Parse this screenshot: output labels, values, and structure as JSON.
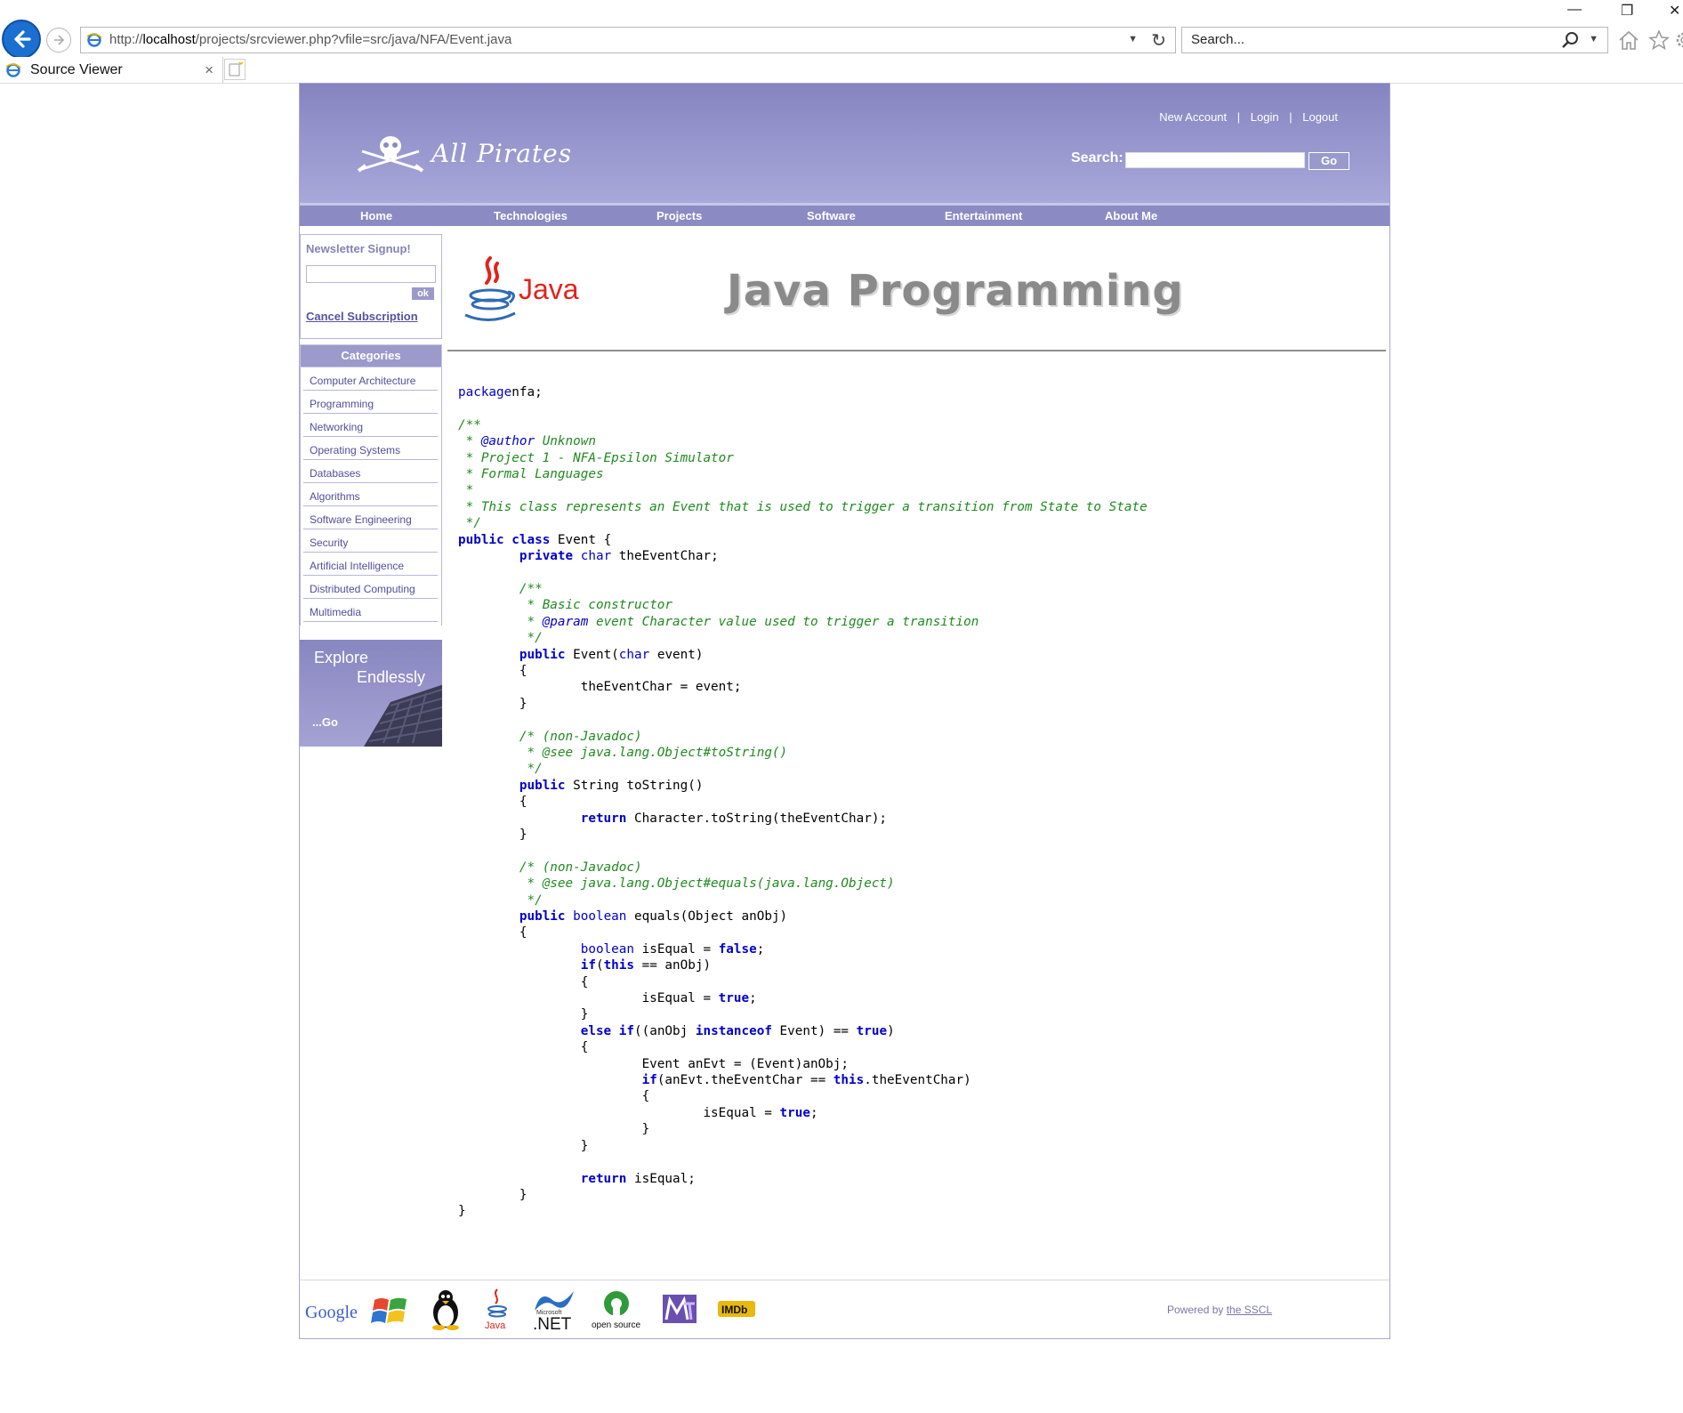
{
  "browser": {
    "url_prefix": "http://",
    "url_host": "localhost",
    "url_path": "/projects/srcviewer.php?vfile=src/java/NFA/Event.java",
    "search_placeholder": "Search...",
    "tab_title": "Source Viewer",
    "tab_close": "×"
  },
  "header": {
    "site_name": "All Pirates",
    "links": [
      "New Account",
      "Login",
      "Logout"
    ],
    "link_separator": "|",
    "search_label": "Search:",
    "go_label": "Go"
  },
  "nav": {
    "items": [
      "Home",
      "Technologies",
      "Projects",
      "Software",
      "Entertainment",
      "About Me"
    ]
  },
  "sidebar": {
    "newsletter_title": "Newsletter Signup!",
    "ok_label": "ok",
    "cancel_label": "Cancel Subscription",
    "categories_title": "Categories",
    "categories": [
      "Computer Architecture",
      "Programming",
      "Networking",
      "Operating Systems",
      "Databases",
      "Algorithms",
      "Software Engineering",
      "Security",
      "Artificial Intelligence",
      "Distributed Computing",
      "Multimedia"
    ],
    "explore_line1": "Explore",
    "explore_line2": "Endlessly",
    "explore_go": "...Go"
  },
  "content": {
    "java_logo_text": "Java",
    "banner_title": "Java Programming",
    "code": [
      [
        [
          "kw",
          "package"
        ],
        [
          "",
          "nfa;"
        ]
      ],
      [],
      [
        [
          "cm",
          "/**"
        ]
      ],
      [
        [
          "cm",
          " * "
        ],
        [
          "tag",
          "@author"
        ],
        [
          "cm",
          " Unknown"
        ]
      ],
      [
        [
          "cm",
          " * Project 1 - NFA-Epsilon Simulator"
        ]
      ],
      [
        [
          "cm",
          " * Formal Languages"
        ]
      ],
      [
        [
          "cm",
          " *"
        ]
      ],
      [
        [
          "cm",
          " * This class represents an Event that is used to trigger a transition from State to State"
        ]
      ],
      [
        [
          "cm",
          " */"
        ]
      ],
      [
        [
          "bkw",
          "public"
        ],
        [
          "",
          " "
        ],
        [
          "bkw",
          "class"
        ],
        [
          "",
          " Event {"
        ]
      ],
      [
        [
          "",
          "        "
        ],
        [
          "bkw",
          "private"
        ],
        [
          "",
          " "
        ],
        [
          "kw",
          "char"
        ],
        [
          "",
          " theEventChar;"
        ]
      ],
      [],
      [
        [
          "",
          "        "
        ],
        [
          "cm",
          "/**"
        ]
      ],
      [
        [
          "",
          "        "
        ],
        [
          "cm",
          " * Basic constructor"
        ]
      ],
      [
        [
          "",
          "        "
        ],
        [
          "cm",
          " * "
        ],
        [
          "tag",
          "@param"
        ],
        [
          "cm",
          " event Character value used to trigger a transition"
        ]
      ],
      [
        [
          "",
          "        "
        ],
        [
          "cm",
          " */"
        ]
      ],
      [
        [
          "",
          "        "
        ],
        [
          "bkw",
          "public"
        ],
        [
          "",
          " Event("
        ],
        [
          "kw",
          "char"
        ],
        [
          "",
          " event)"
        ]
      ],
      [
        [
          "",
          "        {"
        ]
      ],
      [
        [
          "",
          "                theEventChar = event;"
        ]
      ],
      [
        [
          "",
          "        }"
        ]
      ],
      [],
      [
        [
          "",
          "        "
        ],
        [
          "cm",
          "/* (non-Javadoc)"
        ]
      ],
      [
        [
          "",
          "        "
        ],
        [
          "cm",
          " * @see java.lang.Object#toString()"
        ]
      ],
      [
        [
          "",
          "        "
        ],
        [
          "cm",
          " */"
        ]
      ],
      [
        [
          "",
          "        "
        ],
        [
          "bkw",
          "public"
        ],
        [
          "",
          " String toString()"
        ]
      ],
      [
        [
          "",
          "        {"
        ]
      ],
      [
        [
          "",
          "                "
        ],
        [
          "bkw",
          "return"
        ],
        [
          "",
          " Character.toString(theEventChar);"
        ]
      ],
      [
        [
          "",
          "        }"
        ]
      ],
      [],
      [
        [
          "",
          "        "
        ],
        [
          "cm",
          "/* (non-Javadoc)"
        ]
      ],
      [
        [
          "",
          "        "
        ],
        [
          "cm",
          " * @see java.lang.Object#equals(java.lang.Object)"
        ]
      ],
      [
        [
          "",
          "        "
        ],
        [
          "cm",
          " */"
        ]
      ],
      [
        [
          "",
          "        "
        ],
        [
          "bkw",
          "public"
        ],
        [
          "",
          " "
        ],
        [
          "kw",
          "boolean"
        ],
        [
          "",
          " equals(Object anObj)"
        ]
      ],
      [
        [
          "",
          "        {"
        ]
      ],
      [
        [
          "",
          "                "
        ],
        [
          "kw",
          "boolean"
        ],
        [
          "",
          " isEqual = "
        ],
        [
          "bkw",
          "false"
        ],
        [
          "",
          ";"
        ]
      ],
      [
        [
          "",
          "                "
        ],
        [
          "bkw",
          "if"
        ],
        [
          "",
          "("
        ],
        [
          "bkw",
          "this"
        ],
        [
          "",
          " == anObj)"
        ]
      ],
      [
        [
          "",
          "                {"
        ]
      ],
      [
        [
          "",
          "                        isEqual = "
        ],
        [
          "bkw",
          "true"
        ],
        [
          "",
          ";"
        ]
      ],
      [
        [
          "",
          "                }"
        ]
      ],
      [
        [
          "",
          "                "
        ],
        [
          "bkw",
          "else"
        ],
        [
          "",
          " "
        ],
        [
          "bkw",
          "if"
        ],
        [
          "",
          "((anObj "
        ],
        [
          "bkw",
          "instanceof"
        ],
        [
          "",
          " Event) == "
        ],
        [
          "bkw",
          "true"
        ],
        [
          "",
          ")"
        ]
      ],
      [
        [
          "",
          "                {"
        ]
      ],
      [
        [
          "",
          "                        Event anEvt = (Event)anObj;"
        ]
      ],
      [
        [
          "",
          "                        "
        ],
        [
          "bkw",
          "if"
        ],
        [
          "",
          "(anEvt.theEventChar == "
        ],
        [
          "bkw",
          "this"
        ],
        [
          "",
          ".theEventChar)"
        ]
      ],
      [
        [
          "",
          "                        {"
        ]
      ],
      [
        [
          "",
          "                                isEqual = "
        ],
        [
          "bkw",
          "true"
        ],
        [
          "",
          ";"
        ]
      ],
      [
        [
          "",
          "                        }"
        ]
      ],
      [
        [
          "",
          "                }"
        ]
      ],
      [],
      [
        [
          "",
          "                "
        ],
        [
          "bkw",
          "return"
        ],
        [
          "",
          " isEqual;"
        ]
      ],
      [
        [
          "",
          "        }"
        ]
      ],
      [
        [
          "",
          "}"
        ]
      ]
    ]
  },
  "footer": {
    "logos": [
      "Google",
      "Windows",
      "Linux",
      "Java",
      "Microsoft .NET",
      "open source",
      "MTV",
      "IMDb"
    ],
    "logo_text": {
      "google": "Google",
      "java": "Java",
      "net_small": "Microsoft",
      "net": ".NET",
      "opensource": "open source",
      "imdb": "IMDb"
    },
    "powered_prefix": "Powered by ",
    "powered_link": "the SSCL"
  },
  "colors": {
    "header_top": "#8584c0",
    "header_bottom": "#a9a8da",
    "nav": "#8b8ac3",
    "link_text": "#504e9c",
    "code_keyword": "#0000cc",
    "code_comment": "#1f8a1f"
  }
}
